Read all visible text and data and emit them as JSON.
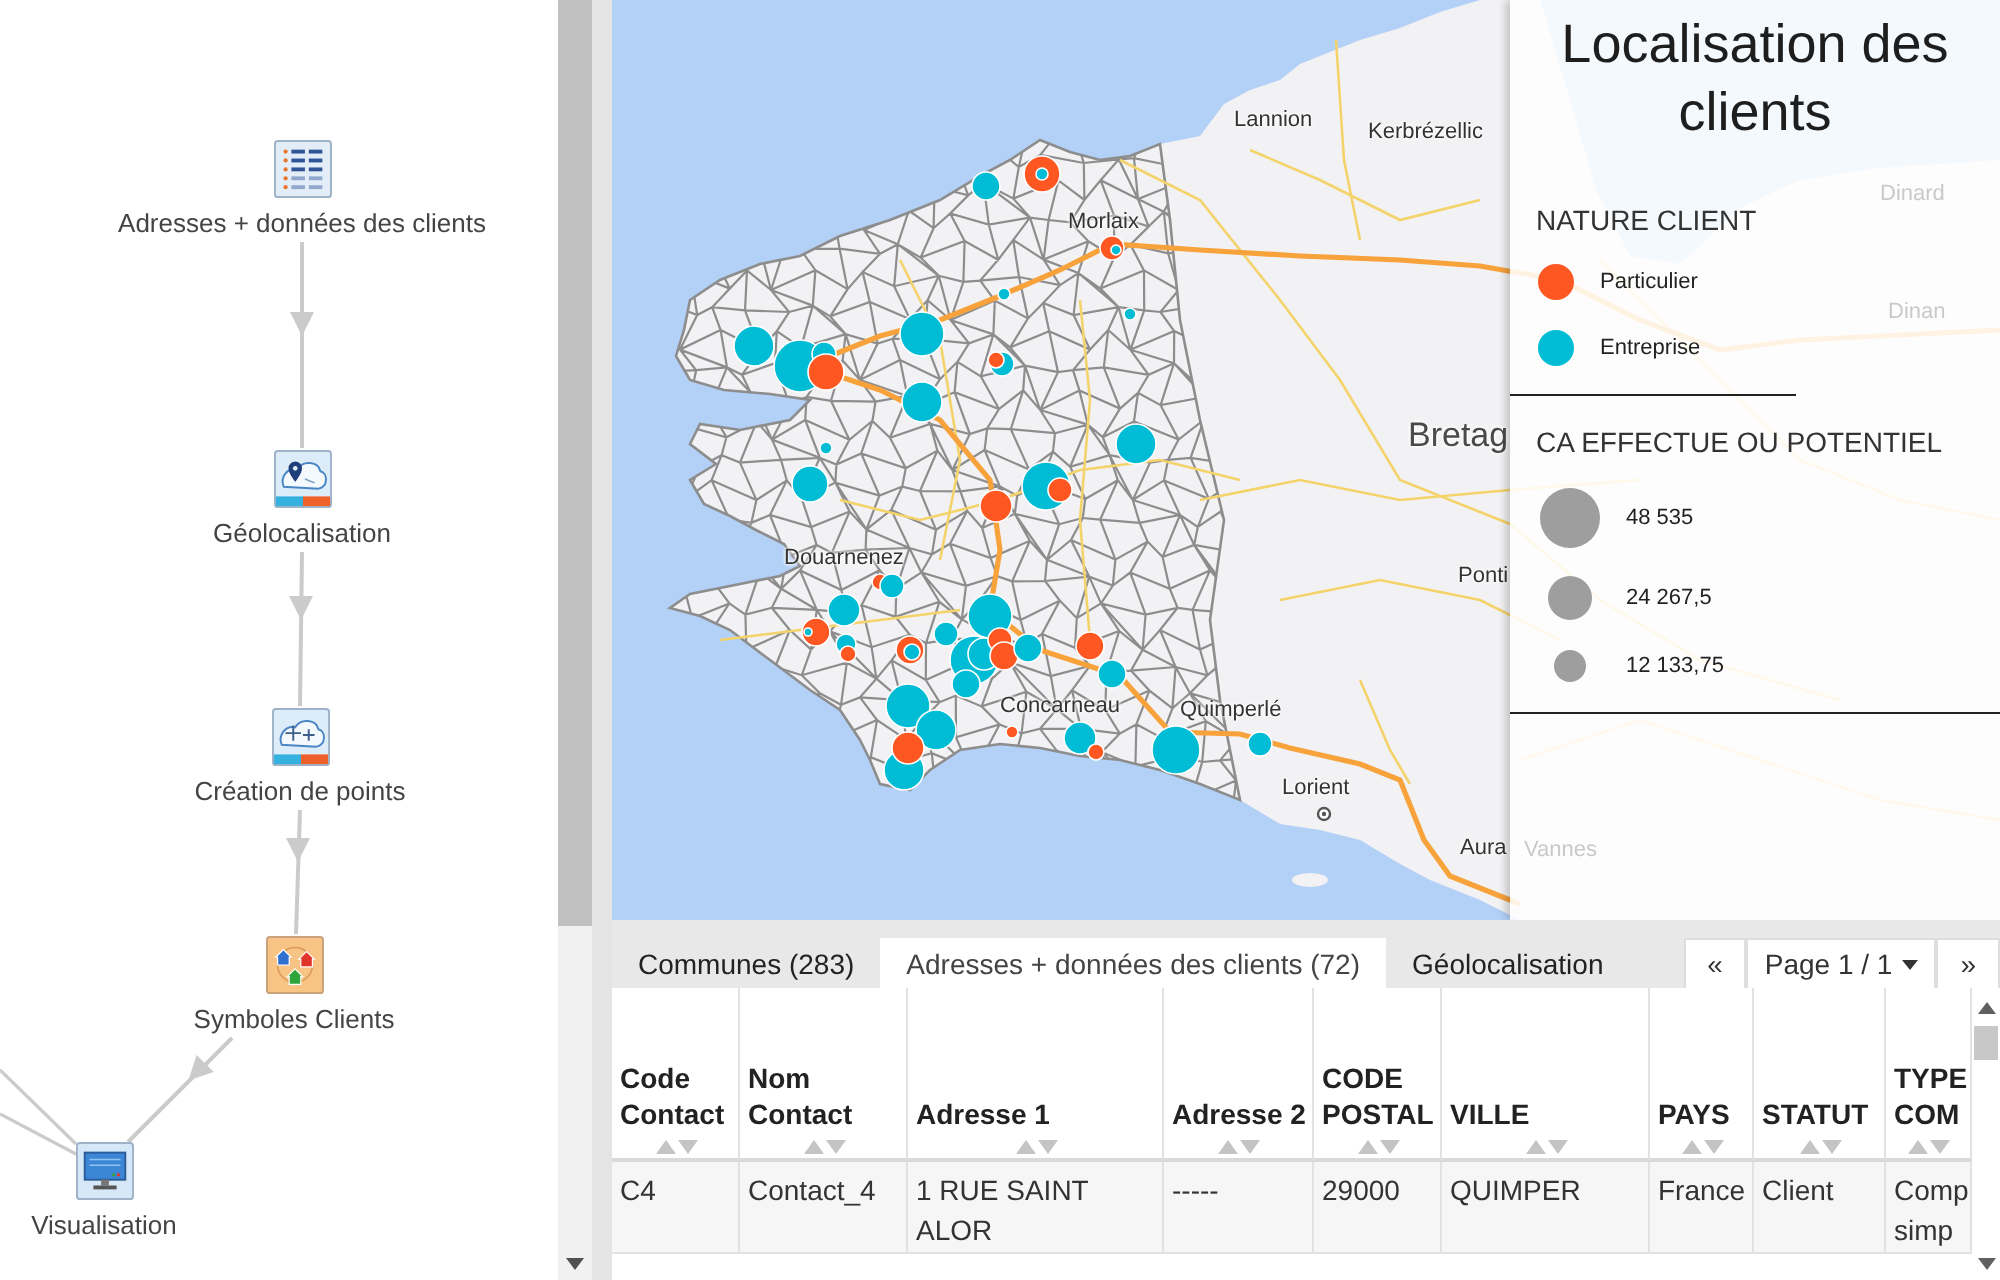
{
  "workflow": {
    "nodes": [
      {
        "label": "Adresses + données des clients",
        "kind": "data"
      },
      {
        "label": "Géolocalisation",
        "kind": "geocode"
      },
      {
        "label": "Création de points",
        "kind": "points"
      },
      {
        "label": "Symboles Clients",
        "kind": "symbols"
      },
      {
        "label": "Visualisation",
        "kind": "display"
      }
    ]
  },
  "map": {
    "places": [
      {
        "text": "Lannion",
        "kind": "town"
      },
      {
        "text": "Kerbrézellic",
        "kind": "town"
      },
      {
        "text": "Morlaix",
        "kind": "town"
      },
      {
        "text": "Bretag",
        "kind": "region"
      },
      {
        "text": "Douarnenez",
        "kind": "town"
      },
      {
        "text": "Ponti",
        "kind": "town"
      },
      {
        "text": "Concarneau",
        "kind": "town"
      },
      {
        "text": "Quimperlé",
        "kind": "town"
      },
      {
        "text": "Lorient",
        "kind": "town"
      },
      {
        "text": "Aura",
        "kind": "town"
      },
      {
        "text": "Dinard",
        "kind": "faint"
      },
      {
        "text": "Dinan",
        "kind": "faint"
      },
      {
        "text": "Vannes",
        "kind": "faint"
      }
    ]
  },
  "legend": {
    "title": "Localisation des clients",
    "sections": [
      {
        "title": "NATURE CLIENT",
        "kind": "color",
        "items": [
          {
            "label": "Particulier",
            "color": "#ff5722"
          },
          {
            "label": "Entreprise",
            "color": "#00bcd4"
          }
        ]
      },
      {
        "title": "CA EFFECTUE OU POTENTIEL",
        "kind": "size",
        "items": [
          {
            "label": "48 535"
          },
          {
            "label": "24 267,5"
          },
          {
            "label": "12 133,75"
          }
        ]
      }
    ]
  },
  "tabs": [
    {
      "label": "Communes (283)",
      "selected": false
    },
    {
      "label": "Adresses + données des clients (72)",
      "selected": true
    },
    {
      "label": "Géolocalisation",
      "selected": false
    }
  ],
  "pager": {
    "previous": "«",
    "page": "Page 1 / 1",
    "next": "»"
  },
  "table": {
    "columns": [
      "Code Contact",
      "Nom Contact",
      "Adresse 1",
      "Adresse 2",
      "CODE POSTAL",
      "VILLE",
      "PAYS",
      "STATUT",
      "TYPE COM"
    ],
    "rows": [
      [
        "C4",
        "Contact_4",
        "1 RUE SAINT ALOR",
        "-----",
        "29000",
        "QUIMPER",
        "France",
        "Client",
        "Comp simp"
      ]
    ]
  }
}
